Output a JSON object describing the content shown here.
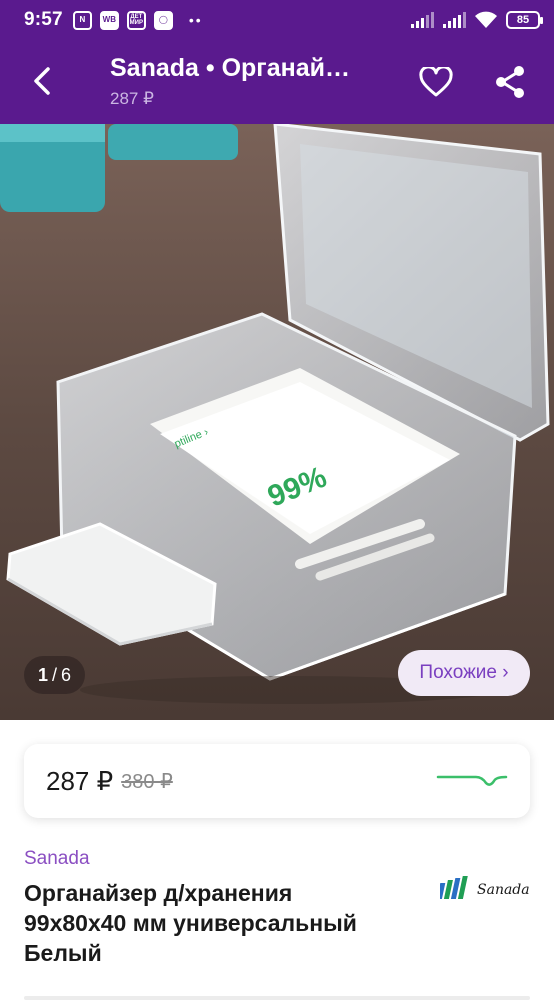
{
  "status_bar": {
    "time": "9:57",
    "left_icons": [
      "nfc-icon",
      "wb-icon",
      "detmir-icon",
      "app-icon"
    ],
    "wb_label": "WB",
    "detmir_label": "ДЕТ МИР",
    "battery": "85"
  },
  "app_bar": {
    "title": "Sanada • Органай…",
    "subtitle": "287 ₽"
  },
  "gallery": {
    "current": "1",
    "separator": "/",
    "total": "6",
    "similar_label": "Похожие ›",
    "pack_text_percent": "99%",
    "pack_text_top": "ptiline ›"
  },
  "price": {
    "current": "287 ₽",
    "old": "380 ₽",
    "graph_color": "#3bbf6a"
  },
  "product": {
    "brand": "Sanada",
    "title": "Органайзер д/хранения 99х80х40 мм универсальный Белый",
    "logo_text": "Sanada"
  },
  "colors": {
    "primary": "#5a1a8e",
    "accent": "#8b4fc2"
  }
}
